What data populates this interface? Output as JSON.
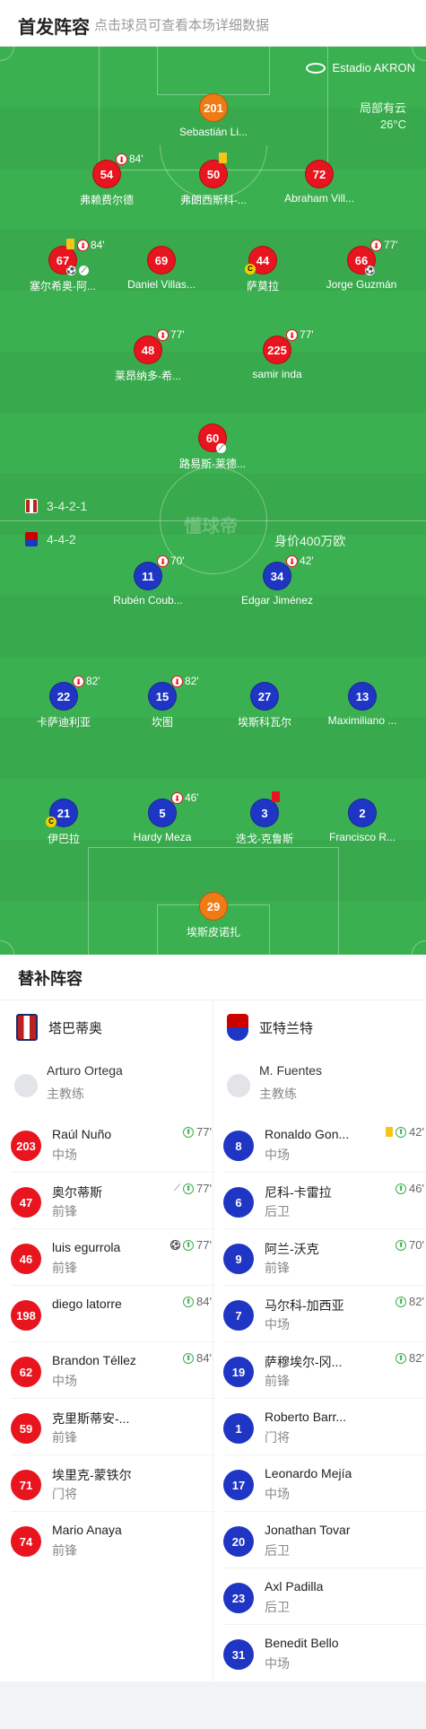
{
  "header": {
    "title": "首发阵容",
    "subtitle": "点击球员可查看本场详细数据"
  },
  "pitch": {
    "stadium": "Estadio AKRON",
    "weather": "局部有云",
    "temperature": "26°C",
    "watermark": "懂球帝",
    "home_formation": "3-4-2-1",
    "away_formation": "4-4-2",
    "away_value": "身价400万欧",
    "home_players": [
      {
        "num": "201",
        "name": "Sebastián Li...",
        "kit": "orange"
      },
      {
        "num": "54",
        "name": "弗赖费尔德",
        "kit": "red",
        "sub_min": "84'"
      },
      {
        "num": "50",
        "name": "弗朗西斯科-...",
        "kit": "red"
      },
      {
        "num": "72",
        "name": "Abraham Vill...",
        "kit": "red"
      },
      {
        "num": "67",
        "name": "塞尔希奥-阿...",
        "kit": "red",
        "sub_min": "84'"
      },
      {
        "num": "69",
        "name": "Daniel Villas...",
        "kit": "red"
      },
      {
        "num": "44",
        "name": "萨莫拉",
        "kit": "red"
      },
      {
        "num": "66",
        "name": "Jorge Guzmán",
        "kit": "red",
        "sub_min": "77'"
      },
      {
        "num": "48",
        "name": "莱昂纳多-希...",
        "kit": "red",
        "sub_min": "77'"
      },
      {
        "num": "225",
        "name": "samir inda",
        "kit": "red",
        "sub_min": "77'"
      },
      {
        "num": "60",
        "name": "路易斯-莱德...",
        "kit": "red"
      }
    ],
    "away_players": [
      {
        "num": "11",
        "name": "Rubén Coub...",
        "kit": "blue",
        "sub_min": "70'"
      },
      {
        "num": "34",
        "name": "Edgar Jiménez",
        "kit": "blue",
        "sub_min": "42'"
      },
      {
        "num": "22",
        "name": "卡萨迪利亚",
        "kit": "blue",
        "sub_min": "82'"
      },
      {
        "num": "15",
        "name": "坎图",
        "kit": "blue",
        "sub_min": "82'"
      },
      {
        "num": "27",
        "name": "埃斯科瓦尔",
        "kit": "blue"
      },
      {
        "num": "13",
        "name": "Maximiliano ...",
        "kit": "blue"
      },
      {
        "num": "21",
        "name": "伊巴拉",
        "kit": "blue"
      },
      {
        "num": "5",
        "name": "Hardy Meza",
        "kit": "blue",
        "sub_min": "46'"
      },
      {
        "num": "3",
        "name": "迭戈-克鲁斯",
        "kit": "blue"
      },
      {
        "num": "2",
        "name": "Francisco R...",
        "kit": "blue"
      },
      {
        "num": "29",
        "name": "埃斯皮诺扎",
        "kit": "orange"
      }
    ]
  },
  "subs": {
    "title": "替补阵容",
    "home_team": "塔巴蒂奥",
    "away_team": "亚特兰特",
    "home_coach": {
      "name": "Arturo Ortega",
      "role": "主教练"
    },
    "away_coach": {
      "name": "M. Fuentes",
      "role": "主教练"
    },
    "home": [
      {
        "num": "203",
        "name": "Raúl Nuño",
        "pos": "中场",
        "min": "77'"
      },
      {
        "num": "47",
        "name": "奥尔蒂斯",
        "pos": "前锋",
        "min": "77'"
      },
      {
        "num": "46",
        "name": "luis egurrola",
        "pos": "前锋",
        "min": "77'"
      },
      {
        "num": "198",
        "name": "diego latorre",
        "pos": "",
        "min": "84'"
      },
      {
        "num": "62",
        "name": "Brandon Téllez",
        "pos": "中场",
        "min": "84'"
      },
      {
        "num": "59",
        "name": "克里斯蒂安-...",
        "pos": "前锋",
        "min": ""
      },
      {
        "num": "71",
        "name": "埃里克-蒙铁尔",
        "pos": "门将",
        "min": ""
      },
      {
        "num": "74",
        "name": "Mario Anaya",
        "pos": "前锋",
        "min": ""
      }
    ],
    "away": [
      {
        "num": "8",
        "name": "Ronaldo Gon...",
        "pos": "中场",
        "min": "42'"
      },
      {
        "num": "6",
        "name": "尼科-卡雷拉",
        "pos": "后卫",
        "min": "46'"
      },
      {
        "num": "9",
        "name": "阿兰-沃克",
        "pos": "前锋",
        "min": "70'"
      },
      {
        "num": "7",
        "name": "马尔科-加西亚",
        "pos": "中场",
        "min": "82'"
      },
      {
        "num": "19",
        "name": "萨穆埃尔-冈...",
        "pos": "前锋",
        "min": "82'"
      },
      {
        "num": "1",
        "name": "Roberto Barr...",
        "pos": "门将",
        "min": ""
      },
      {
        "num": "17",
        "name": "Leonardo Mejía",
        "pos": "中场",
        "min": ""
      },
      {
        "num": "20",
        "name": "Jonathan Tovar",
        "pos": "后卫",
        "min": ""
      },
      {
        "num": "23",
        "name": "Axl Padilla",
        "pos": "后卫",
        "min": ""
      },
      {
        "num": "31",
        "name": "Benedit Bello",
        "pos": "中场",
        "min": ""
      }
    ]
  },
  "colors": {
    "pitch": "#3bb050",
    "home_kit": "#e8141e",
    "away_kit": "#1f36c4",
    "keeper_kit": "#f07a14",
    "yellow_card": "#f5c518",
    "red_card": "#e8141e",
    "sub_in": "#38b04b"
  },
  "icons": [
    "stadium-icon",
    "sub-off-icon",
    "sub-in-icon",
    "yellow-card-icon",
    "red-card-icon",
    "goal-ball-icon",
    "assist-boot-icon",
    "captain-icon",
    "coach-avatar-icon",
    "team-logo-icon"
  ]
}
